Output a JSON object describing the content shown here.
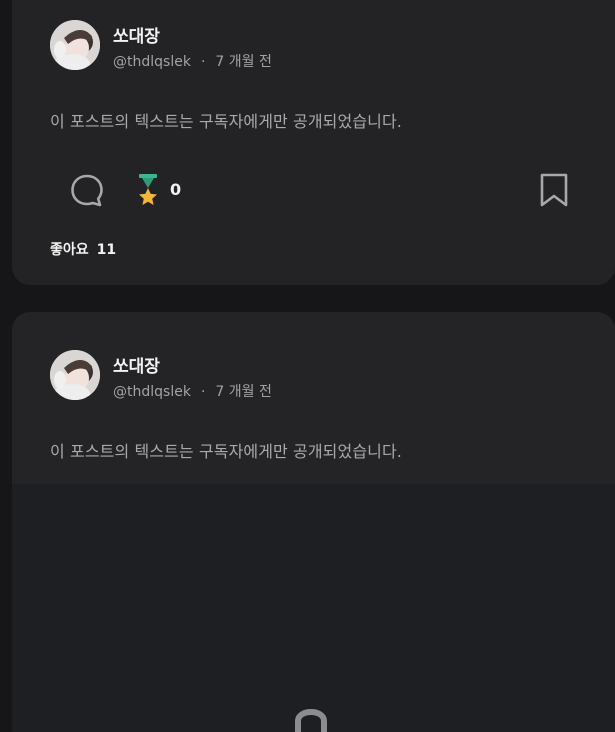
{
  "posts": [
    {
      "author_name": "쏘대장",
      "handle": "@thdlqslek",
      "separator": "·",
      "time_ago": "7 개월 전",
      "text": "이 포스트의 텍스트는 구독자에게만 공개되었습니다.",
      "award_count": "0",
      "likes_label": "좋아요",
      "likes_count": "11"
    },
    {
      "author_name": "쏘대장",
      "handle": "@thdlqslek",
      "separator": "·",
      "time_ago": "7 개월 전",
      "text": "이 포스트의 텍스트는 구독자에게만 공개되었습니다."
    }
  ],
  "icons": {
    "comment": "comment-icon",
    "award": "award-medal-icon",
    "bookmark": "bookmark-icon",
    "lock": "lock-icon"
  },
  "colors": {
    "background": "#161618",
    "card": "#232325",
    "award_ribbon": "#3fb58f",
    "award_star": "#f2b73a"
  }
}
